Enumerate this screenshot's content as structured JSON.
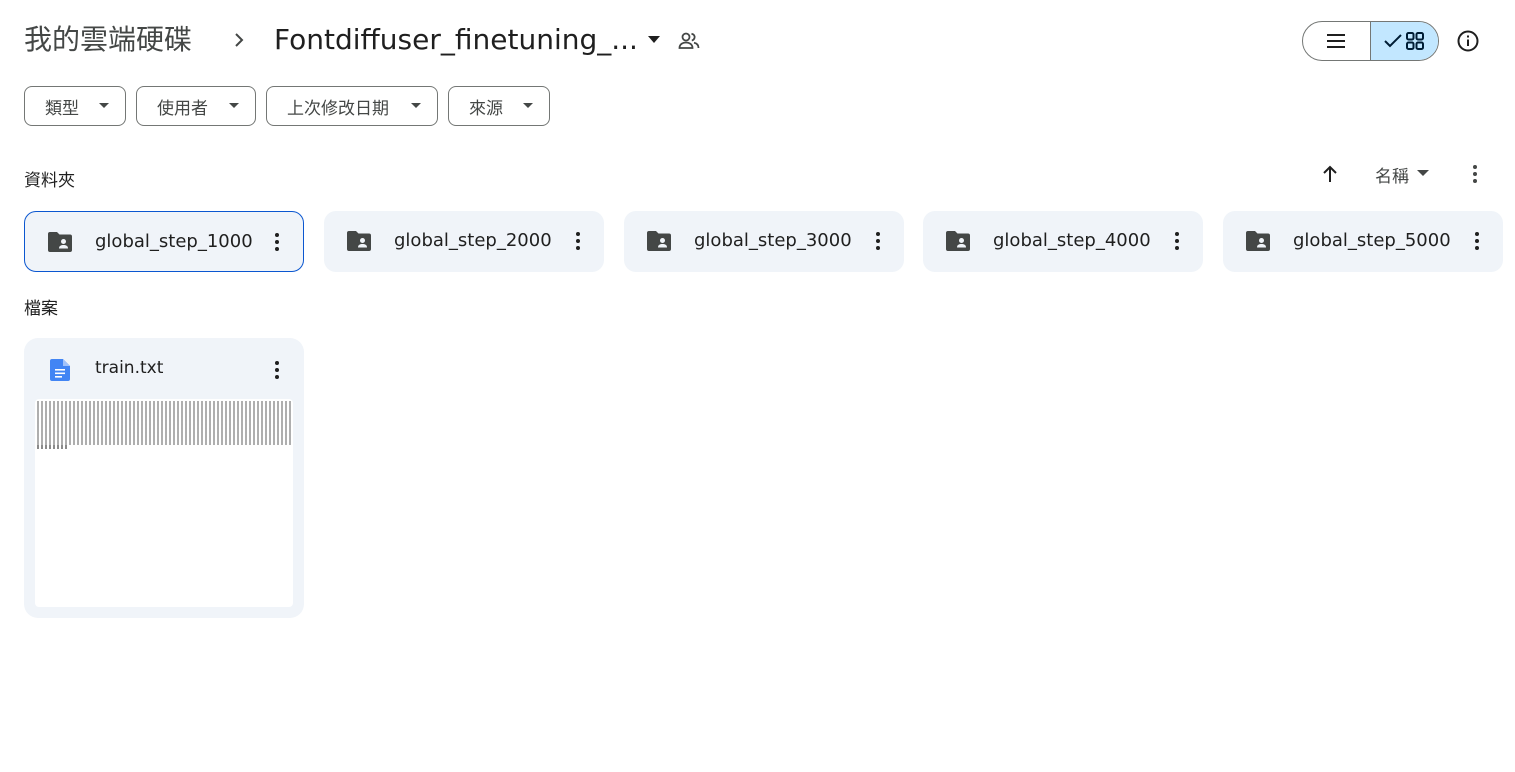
{
  "breadcrumb": {
    "root": "我的雲端硬碟",
    "current": "Fontdiffuser_finetuning_..."
  },
  "toolbar": {
    "icons": [
      "list-view-icon",
      "check-icon",
      "grid-view-icon",
      "info-icon",
      "shared-people-icon"
    ]
  },
  "filters": [
    {
      "label": "類型"
    },
    {
      "label": "使用者"
    },
    {
      "label": "上次修改日期"
    },
    {
      "label": "來源"
    }
  ],
  "folders_section": {
    "title": "資料夾",
    "sort_label": "名稱"
  },
  "folders": [
    {
      "name": "global_step_1000",
      "selected": true
    },
    {
      "name": "global_step_2000",
      "selected": false
    },
    {
      "name": "global_step_3000",
      "selected": false
    },
    {
      "name": "global_step_4000",
      "selected": false
    },
    {
      "name": "global_step_5000",
      "selected": false
    }
  ],
  "files_section": {
    "title": "檔案"
  },
  "files": [
    {
      "name": "train.txt",
      "icon": "google-docs-icon"
    }
  ],
  "colors": {
    "accent": "#0b57d0",
    "selected_bg": "#c2e7ff",
    "card_bg": "#f0f4f9",
    "docs_blue": "#4285f4"
  }
}
